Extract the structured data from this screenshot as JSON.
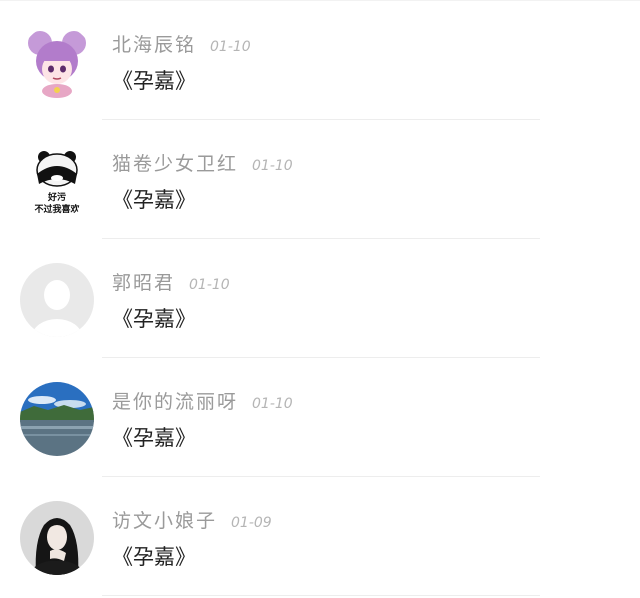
{
  "comments": [
    {
      "username": "北海辰铭",
      "date": "01-10",
      "text": "《孕嘉》",
      "avatar": "anime-girl-avatar"
    },
    {
      "username": "猫卷少女卫红",
      "date": "01-10",
      "text": "《孕嘉》",
      "avatar": "panda-meme-avatar",
      "avatar_caption": [
        "好污",
        "不过我喜欢"
      ]
    },
    {
      "username": "郭昭君",
      "date": "01-10",
      "text": "《孕嘉》",
      "avatar": "default-user-avatar"
    },
    {
      "username": "是你的流丽呀",
      "date": "01-10",
      "text": "《孕嘉》",
      "avatar": "lake-landscape-avatar"
    },
    {
      "username": "访文小娘子",
      "date": "01-09",
      "text": "《孕嘉》",
      "avatar": "woman-photo-avatar"
    }
  ]
}
